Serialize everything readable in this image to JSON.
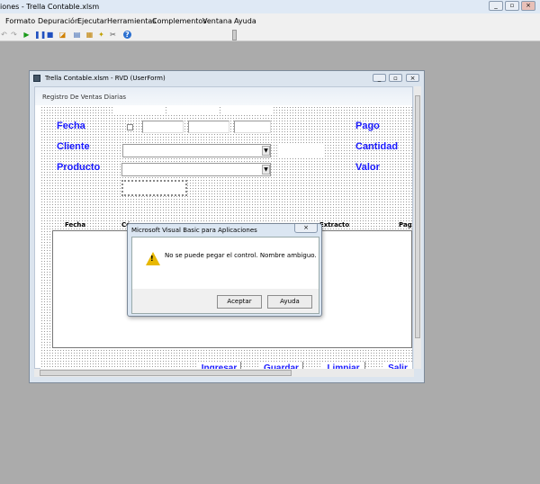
{
  "app": {
    "title": "iones - Trella Contable.xlsm"
  },
  "menu": [
    "Formato",
    "Depuración",
    "Ejecutar",
    "Herramientas",
    "Complementos",
    "Ventana",
    "Ayuda"
  ],
  "window": {
    "title": "Trella Contable.xlsm - RVD (UserForm)"
  },
  "form": {
    "caption": "Registro De Ventas Diarias",
    "labels": {
      "fecha": "Fecha",
      "cliente": "Cliente",
      "producto": "Producto",
      "pago": "Pago",
      "cantidad": "Cantidad",
      "valor": "Valor"
    },
    "list_headers": [
      "Fecha",
      "Có",
      "Extracto",
      "Pag"
    ],
    "buttons": [
      "Ingresar",
      "Guardar",
      "Limpiar",
      "Salir"
    ]
  },
  "dialog": {
    "title": "Microsoft Visual Basic para Aplicaciones",
    "message": "No se puede pegar el control. Nombre ambiguo.",
    "ok": "Aceptar",
    "help": "Ayuda"
  }
}
